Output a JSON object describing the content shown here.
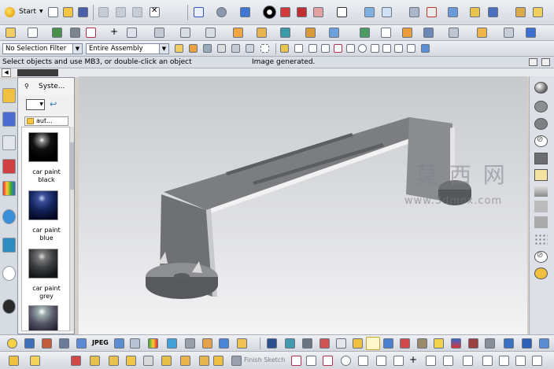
{
  "toolbar": {
    "start_label": "Start",
    "selection_filter": "No Selection Filter",
    "assembly_scope": "Entire Assembly",
    "finish_sketch": "Finish Sketch",
    "jpeg_label": "JPEG"
  },
  "status": {
    "prompt": "Select objects and use MB3, or double-click an object",
    "message": "Image generated."
  },
  "resource_panel": {
    "title": "Syste...",
    "folder": "aut...",
    "materials": [
      {
        "line1": "car paint",
        "line2": "black",
        "color": "#111111"
      },
      {
        "line1": "car paint",
        "line2": "blue",
        "color": "#14245c"
      },
      {
        "line1": "car paint",
        "line2": "grey",
        "color": "#3a3c40"
      }
    ]
  },
  "watermark": {
    "chinese": "莫 西 网",
    "url": "www.3dmox.com"
  },
  "colors": {
    "toolbar_bg": "#e3e6eb",
    "panel_bg": "#f0f0f0",
    "viewport_top": "#c7c9cd",
    "viewport_bottom": "#f4f4f5",
    "model_gray": "#7d7f83"
  }
}
